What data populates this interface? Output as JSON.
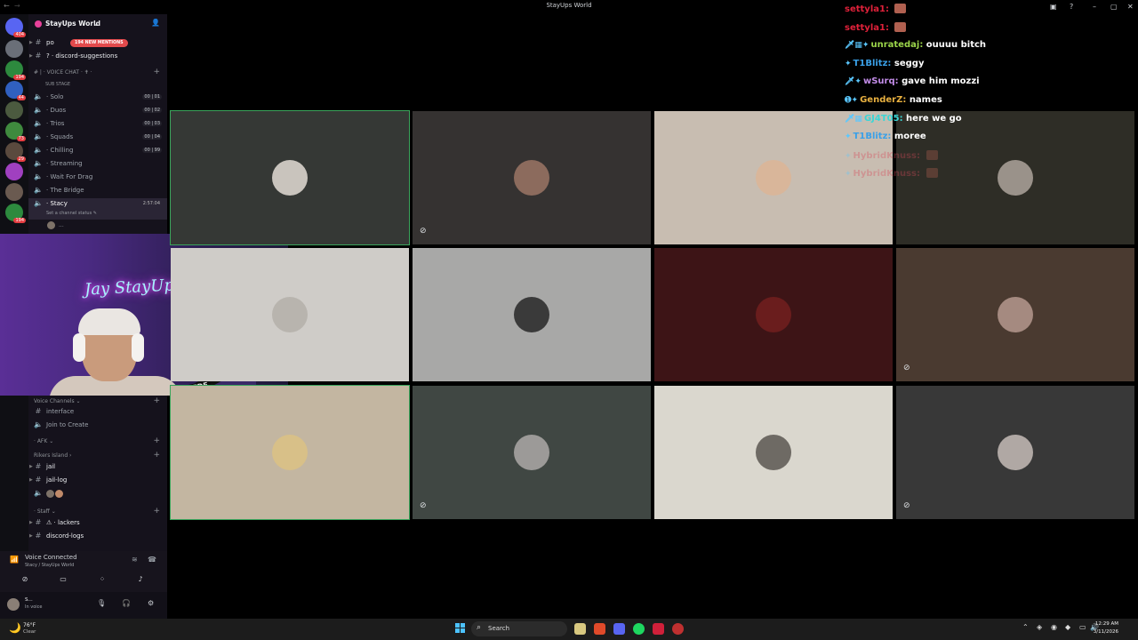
{
  "window": {
    "title": "StayUps World"
  },
  "server": {
    "name": "StayUps World",
    "mentions_badge": "194 NEW MENTIONS",
    "rail_badges": [
      "404",
      "194",
      "44",
      "73",
      "29",
      "194"
    ]
  },
  "channels_top": [
    {
      "icon": "#",
      "label": "po",
      "bright": true
    },
    {
      "icon": "#",
      "label": "? · discord-suggestions",
      "bright": true
    }
  ],
  "voice_chat_category": "# | · VOICE CHAT · ✝ ·",
  "sub_stage": "SUB STAGE",
  "voice_channels": [
    {
      "label": "· Solo",
      "count": "00 | 01"
    },
    {
      "label": "· Duos",
      "count": "00 | 02"
    },
    {
      "label": "· Trios",
      "count": "00 | 03"
    },
    {
      "label": "· Squads",
      "count": "00 | 04"
    },
    {
      "label": "· Chilling",
      "count": "00 | 99"
    },
    {
      "label": "· Streaming",
      "count": ""
    },
    {
      "label": "· Wait For Drag",
      "count": ""
    },
    {
      "label": "· The Bridge",
      "count": ""
    }
  ],
  "stacy_channel": {
    "label": "· Stacy",
    "timer": "2:57:04",
    "status": "Set a channel status ✎",
    "member": "..."
  },
  "lower_sections": {
    "voice_channels_cat": "Voice Channels ⌄",
    "interface": "interface",
    "join_to_create": "Join to Create",
    "afk_cat": "· AFK ⌄",
    "rikers_cat": "Rikers Island ›",
    "jail": "jail",
    "jail_log": "jail-log",
    "staff_cat": "· Staff ⌄",
    "lackers": "⚠ · lackers",
    "discord_logs": "discord-logs"
  },
  "voice_panel": {
    "title": "Voice Connected",
    "subtitle": "Stacy / StayUps World"
  },
  "user_panel": {
    "name": "S...",
    "status": "In voice"
  },
  "cam": {
    "neon_sign": "Jay StayUp",
    "mic_brand": "RØDE"
  },
  "tiles": [
    {
      "bg": "#353835",
      "avatar": "#c9c4bd",
      "speaking": true,
      "muted": false
    },
    {
      "bg": "#353231",
      "avatar": "#8c6b5d",
      "speaking": false,
      "muted": true
    },
    {
      "bg": "#c8bdb1",
      "avatar": "#d9b69a",
      "speaking": false,
      "muted": false
    },
    {
      "bg": "#2e2d26",
      "avatar": "#9a928a",
      "speaking": false,
      "muted": false
    },
    {
      "bg": "#cfccc8",
      "avatar": "#b8b4ae",
      "speaking": false,
      "muted": false
    },
    {
      "bg": "#a8a8a7",
      "avatar": "#3a3a3a",
      "speaking": false,
      "muted": false
    },
    {
      "bg": "#3d1416",
      "avatar": "#6a1d1d",
      "speaking": false,
      "muted": false
    },
    {
      "bg": "#4a3a30",
      "avatar": "#a58a80",
      "speaking": false,
      "muted": true
    },
    {
      "bg": "#c3b6a1",
      "avatar": "#d8c088",
      "speaking": true,
      "muted": false
    },
    {
      "bg": "#404743",
      "avatar": "#9c9a98",
      "speaking": false,
      "muted": true
    },
    {
      "bg": "#dad7ce",
      "avatar": "#6e6a64",
      "speaking": false,
      "muted": false
    },
    {
      "bg": "#383838",
      "avatar": "#b0a8a4",
      "speaking": false,
      "muted": true
    }
  ],
  "chat": [
    {
      "badges": "",
      "user": "settyla1",
      "color": "#e0213a",
      "text": "",
      "emote": true,
      "faded": false
    },
    {
      "badges": "",
      "user": "settyla1",
      "color": "#e0213a",
      "text": "",
      "emote": true,
      "faded": false
    },
    {
      "badges": "🗡▦✦",
      "user": "unratedaj",
      "color": "#9bd54a",
      "text": "ouuuu bitch",
      "emote": false,
      "faded": false
    },
    {
      "badges": "✦",
      "user": "T1Blitz",
      "color": "#3aa0e8",
      "text": "seggy",
      "emote": false,
      "faded": false
    },
    {
      "badges": "🗡✦",
      "user": "wSurq",
      "color": "#c28ce8",
      "text": "gave him mozzi",
      "emote": false,
      "faded": false
    },
    {
      "badges": "➊✦",
      "user": "GenderZ",
      "color": "#e8b040",
      "text": "names",
      "emote": false,
      "faded": false
    },
    {
      "badges": "🗡▦",
      "user": "GJ4T05",
      "color": "#3ad6d6",
      "text": "here we go",
      "emote": false,
      "faded": false
    },
    {
      "badges": "✦",
      "user": "T1Blitz",
      "color": "#3aa0e8",
      "text": "moree",
      "emote": false,
      "faded": false
    },
    {
      "badges": "✦",
      "user": "HybridKnuss",
      "color": "#d84a5a",
      "text": "",
      "emote": true,
      "faded": true
    },
    {
      "badges": "✦",
      "user": "HybridKnuss",
      "color": "#d84a5a",
      "text": "",
      "emote": true,
      "faded": true
    }
  ],
  "taskbar": {
    "weather_temp": "76°F",
    "weather_desc": "Clear",
    "search_label": "Search",
    "time": "12:29 AM",
    "date": "3/11/2026"
  }
}
